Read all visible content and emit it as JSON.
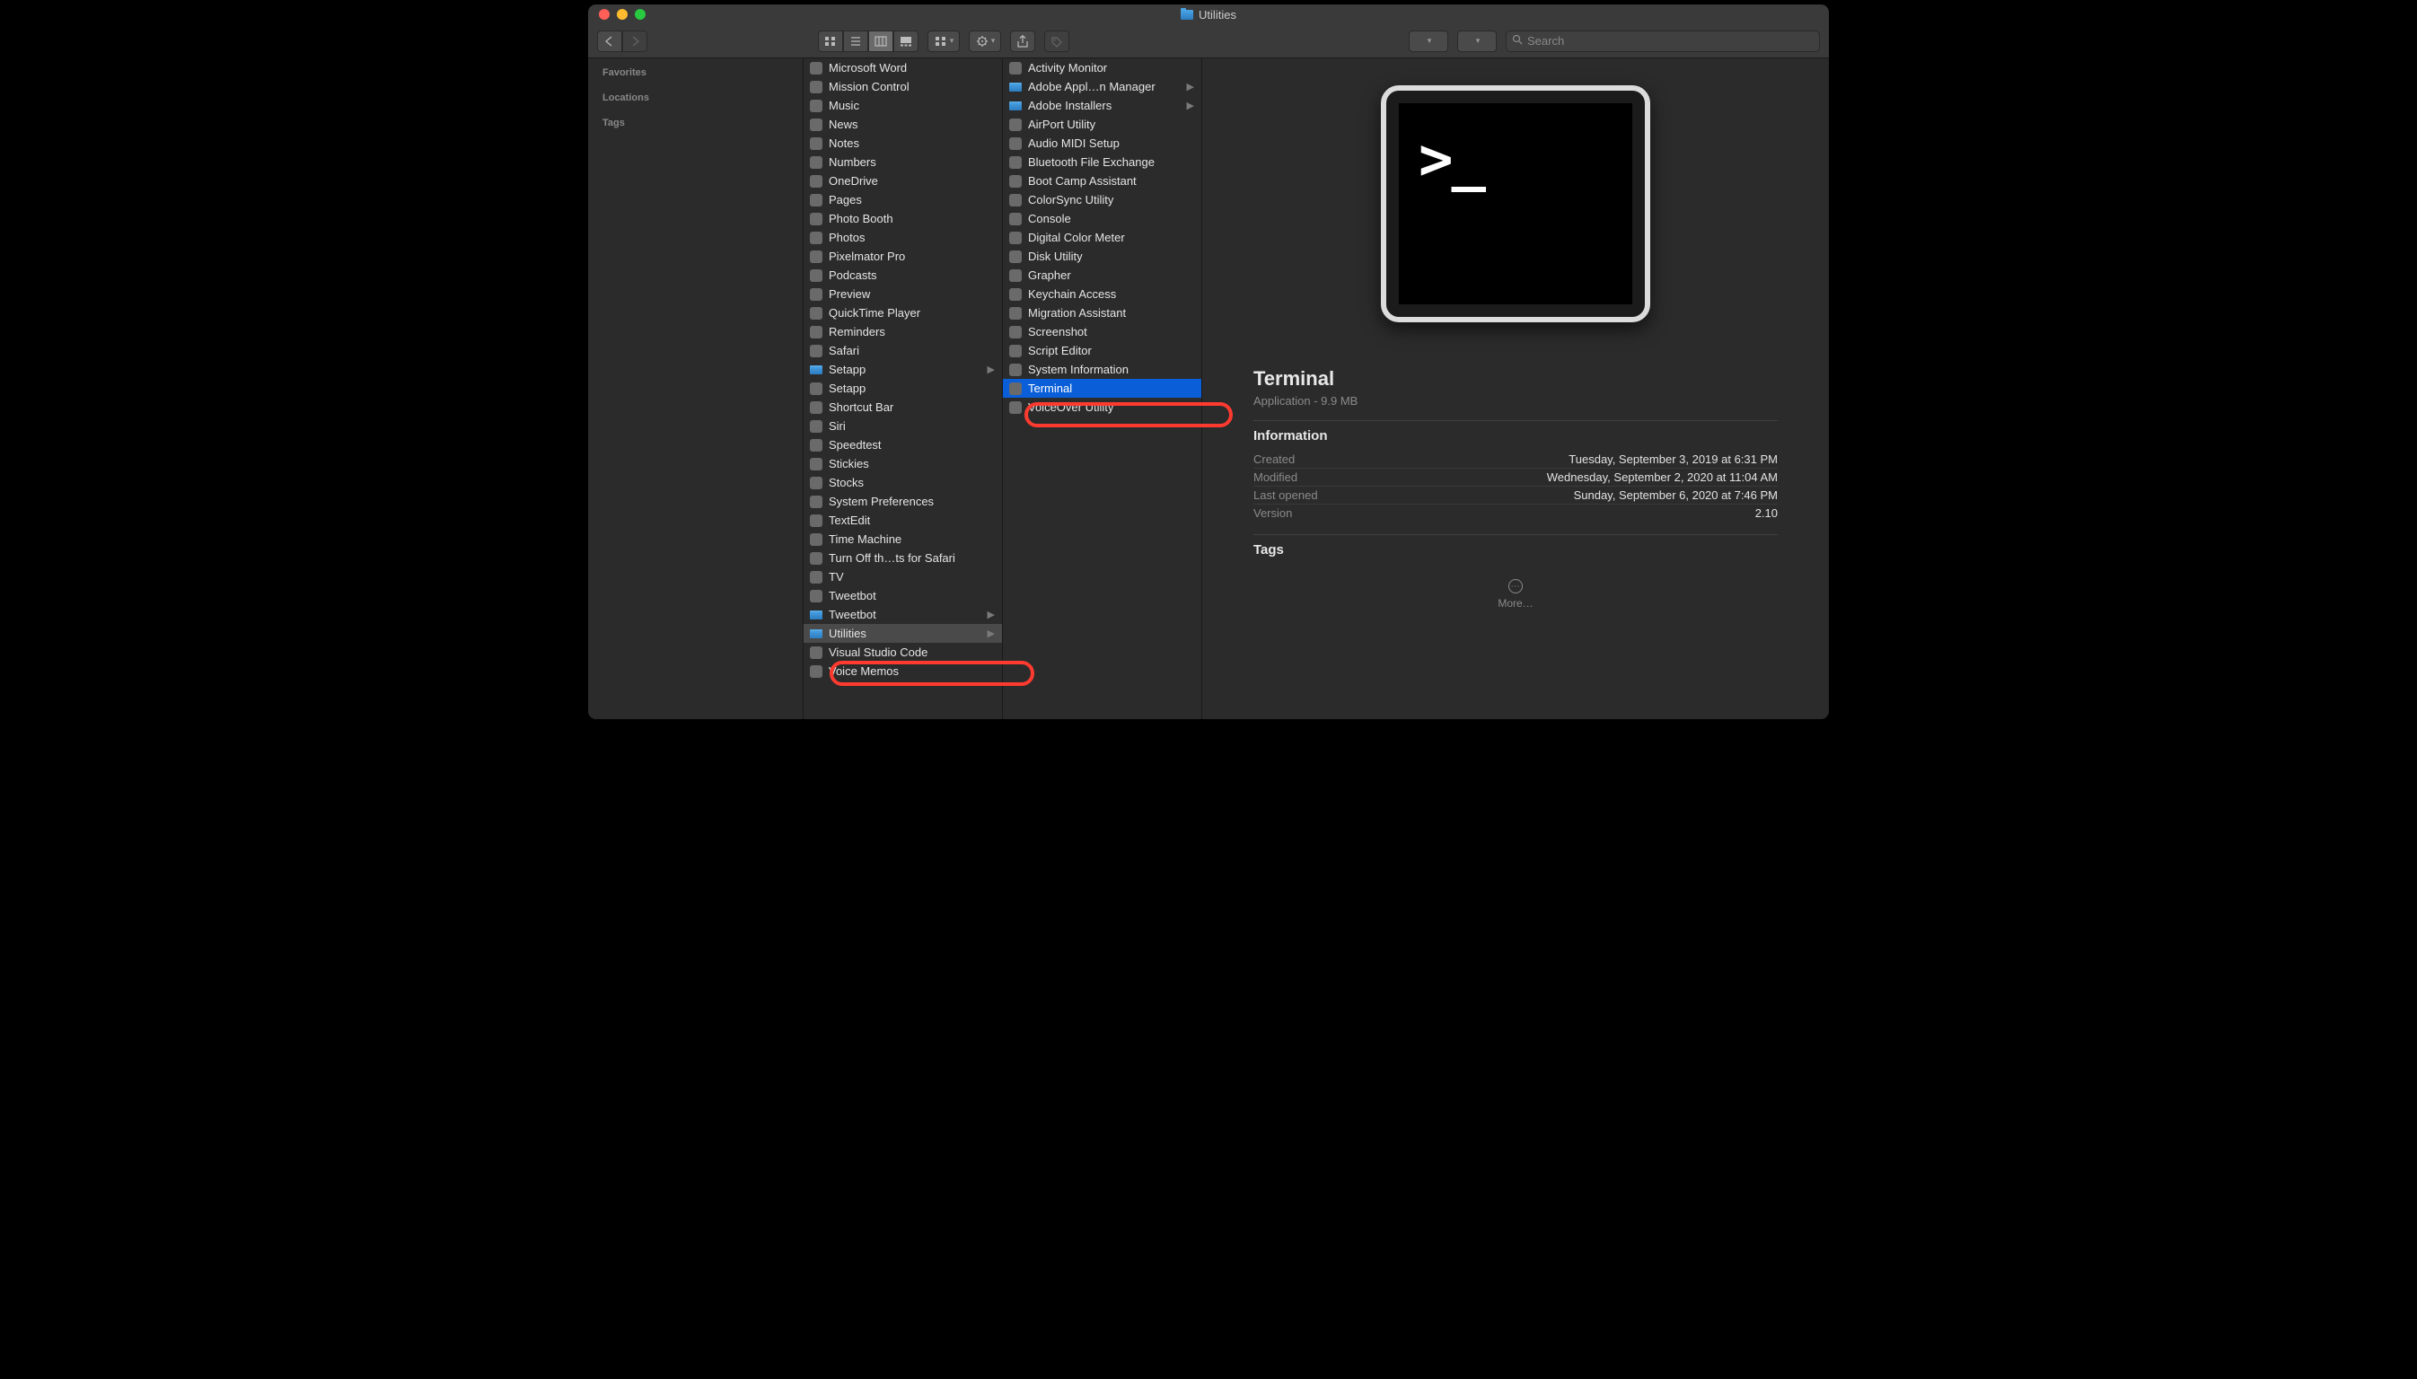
{
  "window": {
    "title": "Utilities"
  },
  "toolbar": {
    "search_placeholder": "Search"
  },
  "sidebar": {
    "sections": [
      "Favorites",
      "Locations",
      "Tags"
    ]
  },
  "col1": [
    {
      "label": "Microsoft Word",
      "type": "app"
    },
    {
      "label": "Mission Control",
      "type": "app"
    },
    {
      "label": "Music",
      "type": "app"
    },
    {
      "label": "News",
      "type": "app"
    },
    {
      "label": "Notes",
      "type": "app"
    },
    {
      "label": "Numbers",
      "type": "app"
    },
    {
      "label": "OneDrive",
      "type": "app"
    },
    {
      "label": "Pages",
      "type": "app"
    },
    {
      "label": "Photo Booth",
      "type": "app"
    },
    {
      "label": "Photos",
      "type": "app"
    },
    {
      "label": "Pixelmator Pro",
      "type": "app"
    },
    {
      "label": "Podcasts",
      "type": "app"
    },
    {
      "label": "Preview",
      "type": "app"
    },
    {
      "label": "QuickTime Player",
      "type": "app"
    },
    {
      "label": "Reminders",
      "type": "app"
    },
    {
      "label": "Safari",
      "type": "app"
    },
    {
      "label": "Setapp",
      "type": "folder",
      "hasChildren": true
    },
    {
      "label": "Setapp",
      "type": "app"
    },
    {
      "label": "Shortcut Bar",
      "type": "app"
    },
    {
      "label": "Siri",
      "type": "app"
    },
    {
      "label": "Speedtest",
      "type": "app"
    },
    {
      "label": "Stickies",
      "type": "app"
    },
    {
      "label": "Stocks",
      "type": "app"
    },
    {
      "label": "System Preferences",
      "type": "app"
    },
    {
      "label": "TextEdit",
      "type": "app"
    },
    {
      "label": "Time Machine",
      "type": "app"
    },
    {
      "label": "Turn Off th…ts for Safari",
      "type": "app"
    },
    {
      "label": "TV",
      "type": "app"
    },
    {
      "label": "Tweetbot",
      "type": "app"
    },
    {
      "label": "Tweetbot",
      "type": "folder",
      "hasChildren": true
    },
    {
      "label": "Utilities",
      "type": "folder",
      "hasChildren": true,
      "selected": true,
      "annotated": true
    },
    {
      "label": "Visual Studio Code",
      "type": "app"
    },
    {
      "label": "Voice Memos",
      "type": "app"
    }
  ],
  "col2": [
    {
      "label": "Activity Monitor",
      "type": "app"
    },
    {
      "label": "Adobe Appl…n Manager",
      "type": "folder",
      "hasChildren": true
    },
    {
      "label": "Adobe Installers",
      "type": "folder",
      "hasChildren": true
    },
    {
      "label": "AirPort Utility",
      "type": "app"
    },
    {
      "label": "Audio MIDI Setup",
      "type": "app"
    },
    {
      "label": "Bluetooth File Exchange",
      "type": "app"
    },
    {
      "label": "Boot Camp Assistant",
      "type": "app"
    },
    {
      "label": "ColorSync Utility",
      "type": "app"
    },
    {
      "label": "Console",
      "type": "app"
    },
    {
      "label": "Digital Color Meter",
      "type": "app"
    },
    {
      "label": "Disk Utility",
      "type": "app"
    },
    {
      "label": "Grapher",
      "type": "app"
    },
    {
      "label": "Keychain Access",
      "type": "app"
    },
    {
      "label": "Migration Assistant",
      "type": "app"
    },
    {
      "label": "Screenshot",
      "type": "app"
    },
    {
      "label": "Script Editor",
      "type": "app"
    },
    {
      "label": "System Information",
      "type": "app"
    },
    {
      "label": "Terminal",
      "type": "app",
      "highlighted": true,
      "annotated": true
    },
    {
      "label": "VoiceOver Utility",
      "type": "app"
    }
  ],
  "preview": {
    "name": "Terminal",
    "subtitle": "Application - 9.9 MB",
    "information_heading": "Information",
    "rows": [
      {
        "k": "Created",
        "v": "Tuesday, September 3, 2019 at 6:31 PM"
      },
      {
        "k": "Modified",
        "v": "Wednesday, September 2, 2020 at 11:04 AM"
      },
      {
        "k": "Last opened",
        "v": "Sunday, September 6, 2020 at 7:46 PM"
      },
      {
        "k": "Version",
        "v": "2.10"
      }
    ],
    "tags_heading": "Tags",
    "more_label": "More…"
  }
}
